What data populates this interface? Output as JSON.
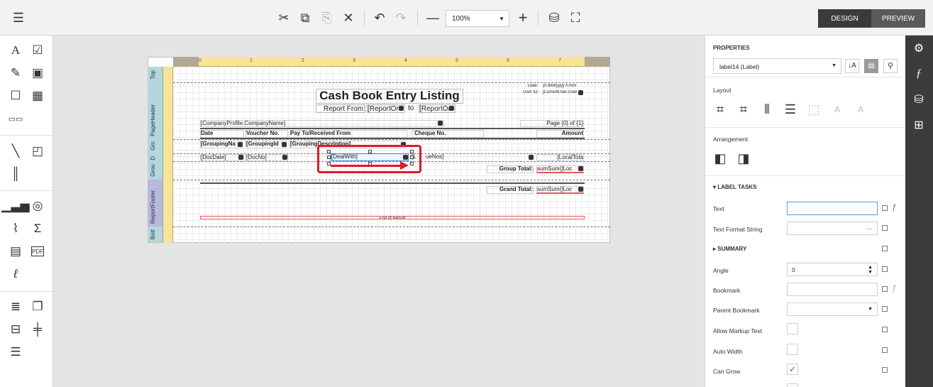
{
  "toolbar": {
    "menu_icon": "hamburger-icon",
    "zoom_value": "100%",
    "design_label": "DESIGN",
    "preview_label": "PREVIEW"
  },
  "ruler": {
    "ticks": [
      "0",
      "1",
      "2",
      "3",
      "4",
      "5",
      "6",
      "7"
    ]
  },
  "bands": {
    "top": "Top",
    "page_header": "PageHeader",
    "group_header": "Grc",
    "detail": "D",
    "group_footer": "Grou",
    "report_footer": "ReportFooter",
    "bottom": "Bott"
  },
  "report": {
    "date_label": "Date:",
    "date_value": "{0:d/M/yyyy h:mm",
    "user_label": "User ID:",
    "user_value": "[CurrentUser.User",
    "title": "Cash Book Entry Listing",
    "report_from": "Report From:",
    "report_from_field": "[ReportOr",
    "to_label": "to",
    "report_to_field": "[ReportOr",
    "company": "[CompanyProfile.CompanyName]",
    "page": "Page {0} of {1}",
    "col_date": "Date",
    "col_voucher": "Voucher No.",
    "col_payto": "Pay To/Received From",
    "col_cheque": "Cheque No.",
    "col_amount": "Amount",
    "grp_name": "[GroupingNa",
    "grp_id": "[GroupingId",
    "grp_desc": "[GroupingDescription]",
    "d_date": "[DocDate]",
    "d_no": "[DocNo]",
    "d_dealwith": "[DealWith]",
    "d_cheque": "ueNos]",
    "d_cheque_prefix": "[L",
    "d_local": "[LocalTota",
    "group_total": "Group Total:",
    "group_sum": "sumSum([Loc",
    "grand_total": "Grand Total:",
    "grand_sum": "sumSum([Loc",
    "end_of_report": "End of Report"
  },
  "properties": {
    "header": "PROPERTIES",
    "selected": "label14 (Label)",
    "layout": "Layout",
    "arrangement": "Arrangement",
    "label_tasks": "LABEL TASKS",
    "text": "Text",
    "text_value": "",
    "text_format": "Text Format String",
    "text_format_btn": "···",
    "summary": "SUMMARY",
    "angle": "Angle",
    "angle_value": "0",
    "bookmark": "Bookmark",
    "parent_bookmark": "Parent Bookmark",
    "allow_markup": "Allow Markup Text",
    "auto_width": "Auto Width",
    "can_grow": "Can Grow"
  }
}
